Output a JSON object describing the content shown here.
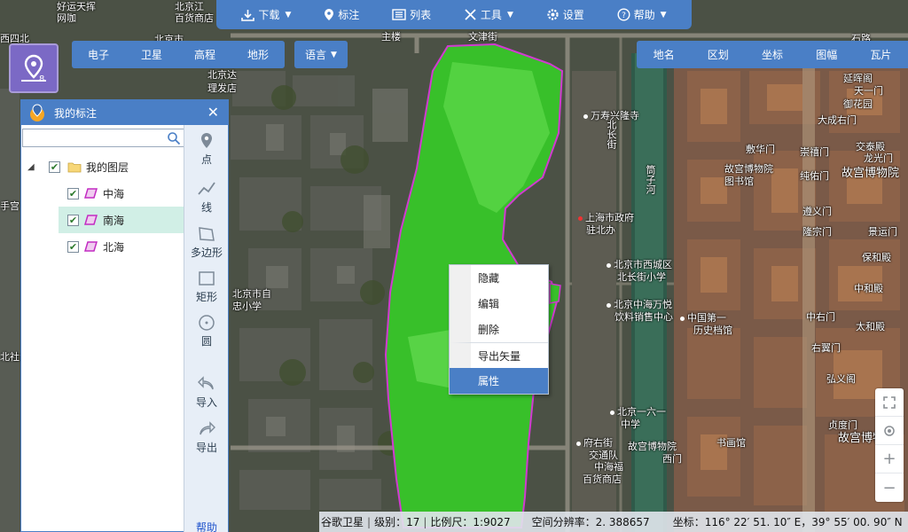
{
  "toolbar": {
    "download": "下载",
    "mark": "标注",
    "list": "列表",
    "tools": "工具",
    "settings": "设置",
    "help": "帮助"
  },
  "map_types": [
    "电子",
    "卫星",
    "高程",
    "地形"
  ],
  "language": "语言",
  "right_bar": [
    "地名",
    "区划",
    "坐标",
    "图幅",
    "瓦片"
  ],
  "panel": {
    "title": "我的标注",
    "search_placeholder": "",
    "root_layer": "我的图层",
    "layers": [
      {
        "name": "中海",
        "checked": true,
        "selected": false
      },
      {
        "name": "南海",
        "checked": true,
        "selected": true
      },
      {
        "name": "北海",
        "checked": true,
        "selected": false
      }
    ]
  },
  "tools": {
    "point": "点",
    "line": "线",
    "polygon": "多边形",
    "rectangle": "矩形",
    "circle": "圆",
    "import": "导入",
    "export": "导出",
    "help": "帮助"
  },
  "context_menu": {
    "hide": "隐藏",
    "edit": "编辑",
    "delete": "删除",
    "export_vector": "导出矢量",
    "properties": "属性"
  },
  "status": {
    "source": "谷歌卫星",
    "level": "级别：17",
    "scale": "比例尺：1:9027",
    "resolution": "空间分辨率：2. 388657",
    "coords": "坐标：116° 22′ 51. 10″ E，39° 55′ 00. 90″ N"
  },
  "map_labels": {
    "l1": "好运天挥",
    "l2": "网咖",
    "l3": "北京江",
    "l4": "百货商店",
    "l5": "北京市",
    "l6": "主楼",
    "l7": "文津街",
    "l8": "北京达",
    "l9": "理发店",
    "l10": "万寿兴隆寺",
    "l11": "北长街",
    "l12": "上海市政府",
    "l13": "驻北办",
    "l14": "北京市西城区",
    "l15": "北长街小学",
    "l16": "北京中海万悦",
    "l17": "饮料销售中心",
    "l18": "中国第一",
    "l19": "历史档馆",
    "l20": "北京市自",
    "l21": "忠小学",
    "l22": "北京一六一",
    "l23": "中学",
    "l24": "府右街",
    "l25": "交通队",
    "l26": "故宫博物院",
    "l27": "西门",
    "l28": "中海福",
    "l29": "百货商店",
    "l30": "书画馆",
    "l31": "筒子河",
    "l32": "延晖阁",
    "l33": "天一门",
    "l34": "御花园",
    "l35": "大成右门",
    "l36": "敷华门",
    "l37": "崇禧门",
    "l38": "交泰殿",
    "l39": "龙光门",
    "l40": "故宫博物院",
    "l41": "图书馆",
    "l42": "纯佑门",
    "l43": "故宫博物院",
    "l44": "遵义门",
    "l45": "隆宗门",
    "l46": "景运门",
    "l47": "保和殿",
    "l48": "中和殿",
    "l49": "中右门",
    "l50": "太和殿",
    "l51": "右翼门",
    "l52": "弘义阁",
    "l53": "贞度门",
    "l54": "故宫博物院",
    "l55": "北社会",
    "l56": "手宫",
    "l57": "西四北",
    "l58": "石路"
  }
}
